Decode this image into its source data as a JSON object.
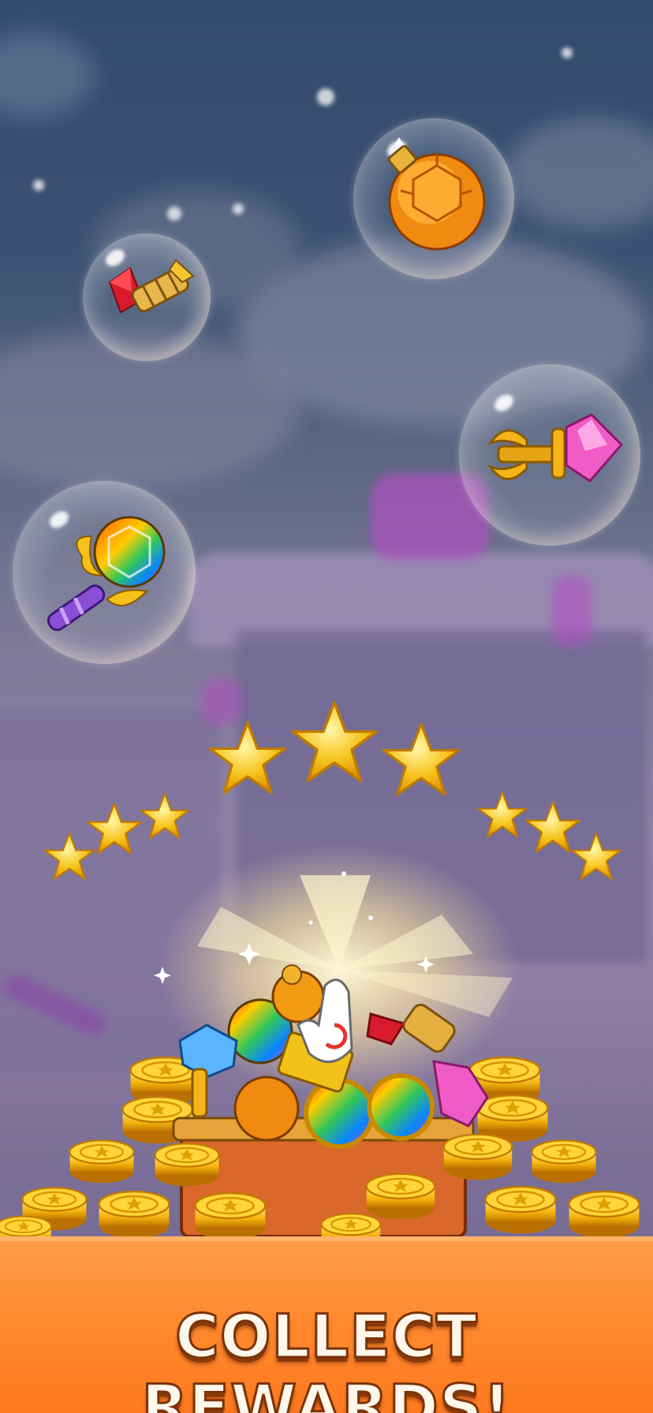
{
  "screen": {
    "headline": "COLLECT REWARDS!"
  },
  "colors": {
    "banner": "#ff8a2f",
    "headline_text": "#fff7ea",
    "headline_outline": "#7a3308",
    "gold": "#f5c21a"
  },
  "reward_bubbles": [
    {
      "item": "firework-rocket",
      "icon": "firework-rocket-icon"
    },
    {
      "item": "orange-gem-bomb",
      "icon": "orange-bomb-icon"
    },
    {
      "item": "pink-gem-arrow",
      "icon": "pink-arrow-icon"
    },
    {
      "item": "rainbow-gem-wand",
      "icon": "rainbow-wand-icon"
    }
  ],
  "stars": {
    "count": 9,
    "color": "#f7c51e"
  },
  "treasure": {
    "contents": [
      "gold coins",
      "rainbow gems",
      "blue gem hammer",
      "gold bars",
      "pink gem",
      "rocket"
    ],
    "icon": "treasure-chest-icon"
  }
}
